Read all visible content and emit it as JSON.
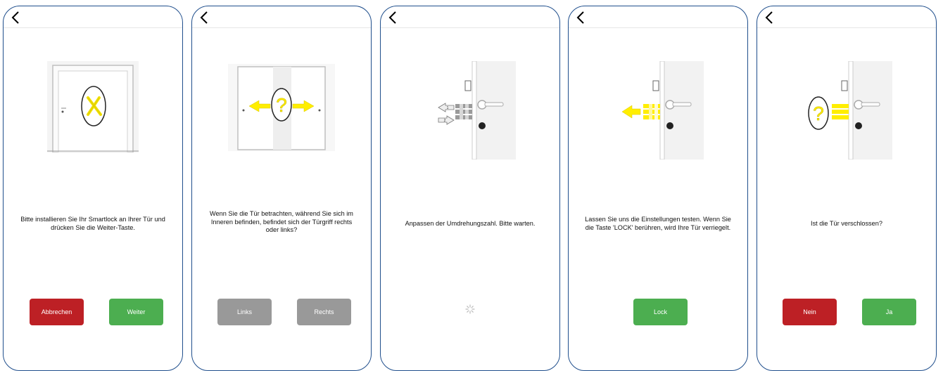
{
  "colors": {
    "border": "#1f4e8c",
    "cancel": "#bd2025",
    "confirm": "#4cae50",
    "neutral": "#999999",
    "accent": "#ffee00"
  },
  "screens": [
    {
      "message": "Bitte installieren Sie Ihr Smartlock an Ihrer Tür und drücken Sie die Weiter-Taste.",
      "buttons": [
        "Abbrechen",
        "Weiter"
      ]
    },
    {
      "message": "Wenn Sie die Tür betrachten, während Sie sich im Inneren befinden, befindet sich der Türgriff rechts oder links?",
      "buttons": [
        "Links",
        "Rechts"
      ]
    },
    {
      "message": "Anpassen der Umdrehungszahl. Bitte warten.",
      "buttons": []
    },
    {
      "message": "Lassen Sie uns die Einstellungen testen. Wenn Sie die Taste 'LOCK' berühren, wird Ihre Tür verriegelt.",
      "buttons": [
        "Lock"
      ]
    },
    {
      "message": "Ist die Tür verschlossen?",
      "buttons": [
        "Nein",
        "Ja"
      ]
    }
  ]
}
